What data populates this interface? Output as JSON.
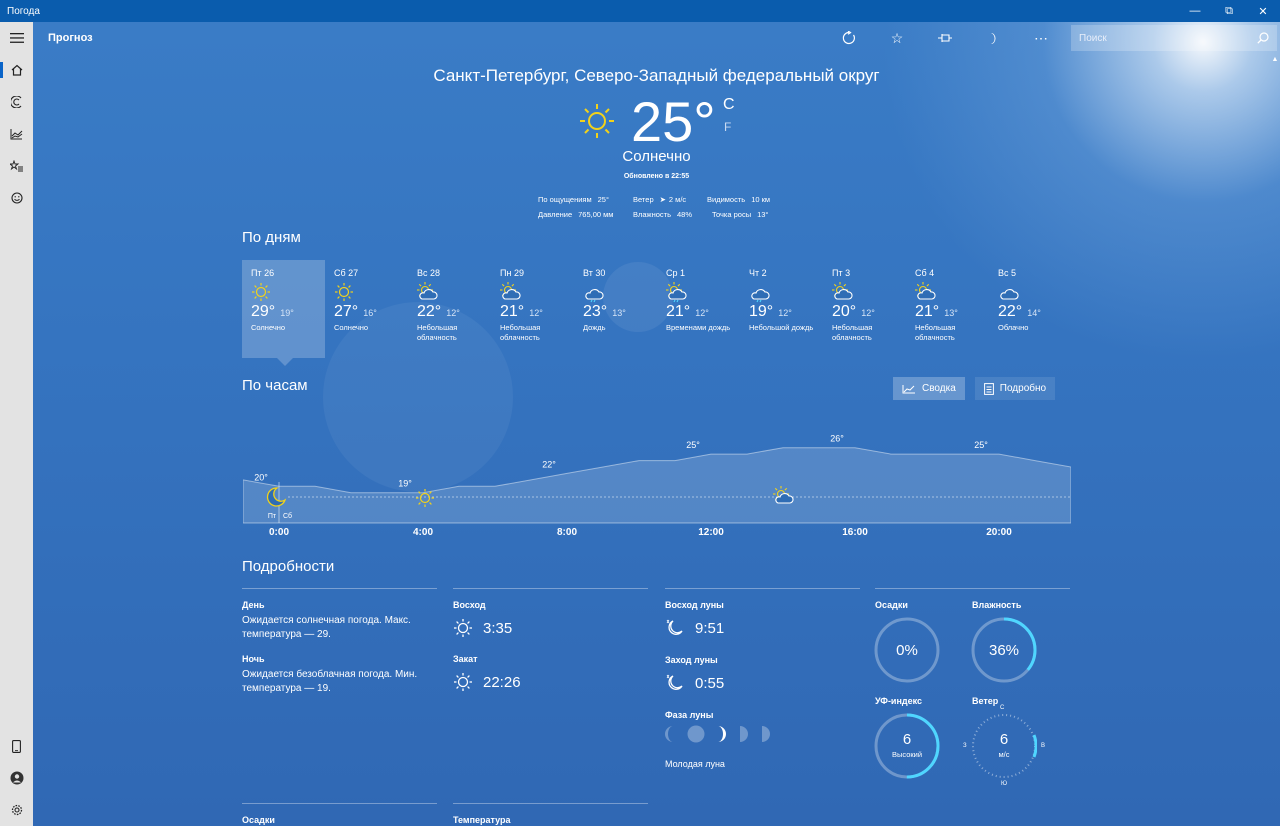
{
  "window": {
    "title": "Погода"
  },
  "nav": {
    "page_title": "Прогноз",
    "search_placeholder": "Поиск"
  },
  "current": {
    "location": "Санкт-Петербург, Северо-Западный федеральный округ",
    "temp": "25°",
    "unit_c": "C",
    "unit_f": "F",
    "condition": "Солнечно",
    "updated": "Обновлено в 22:55",
    "stats": {
      "feels_label": "По ощущениям",
      "feels_value": "25°",
      "wind_label": "Ветер",
      "wind_value": "2 м/с",
      "visibility_label": "Видимость",
      "visibility_value": "10 км",
      "pressure_label": "Давление",
      "pressure_value": "765,00 мм",
      "humidity_label": "Влажность",
      "humidity_value": "48%",
      "dew_label": "Точка росы",
      "dew_value": "13°"
    }
  },
  "daily": {
    "heading": "По дням",
    "days": [
      {
        "name": "Пт 26",
        "icon": "sun-icon",
        "hi": "29°",
        "lo": "19°",
        "cond": "Солнечно"
      },
      {
        "name": "Сб 27",
        "icon": "sun-icon",
        "hi": "27°",
        "lo": "16°",
        "cond": "Солнечно"
      },
      {
        "name": "Вс 28",
        "icon": "partly-cloudy-icon",
        "hi": "22°",
        "lo": "12°",
        "cond": "Небольшая облачность"
      },
      {
        "name": "Пн 29",
        "icon": "partly-cloudy-icon",
        "hi": "21°",
        "lo": "12°",
        "cond": "Небольшая облачность"
      },
      {
        "name": "Вт 30",
        "icon": "rain-icon",
        "hi": "23°",
        "lo": "13°",
        "cond": "Дождь"
      },
      {
        "name": "Ср 1",
        "icon": "sun-rain-icon",
        "hi": "21°",
        "lo": "12°",
        "cond": "Временами дождь"
      },
      {
        "name": "Чт 2",
        "icon": "rain-icon",
        "hi": "19°",
        "lo": "12°",
        "cond": "Небольшой дождь"
      },
      {
        "name": "Пт 3",
        "icon": "partly-cloudy-icon",
        "hi": "20°",
        "lo": "12°",
        "cond": "Небольшая облачность"
      },
      {
        "name": "Сб 4",
        "icon": "partly-cloudy-icon",
        "hi": "21°",
        "lo": "13°",
        "cond": "Небольшая облачность"
      },
      {
        "name": "Вс 5",
        "icon": "cloud-icon",
        "hi": "22°",
        "lo": "14°",
        "cond": "Облачно"
      }
    ]
  },
  "hourly": {
    "heading": "По часам",
    "summary_label": "Сводка",
    "detail_label": "Подробно",
    "day_labels": [
      "Пт",
      "Сб"
    ],
    "hour_labels": [
      "0:00",
      "4:00",
      "8:00",
      "12:00",
      "16:00",
      "20:00"
    ],
    "temp_points": [
      {
        "hour": 1,
        "label": "20°"
      },
      {
        "hour": 5,
        "label": "19°"
      },
      {
        "hour": 9,
        "label": "22°"
      },
      {
        "hour": 13,
        "label": "25°"
      },
      {
        "hour": 17,
        "label": "26°"
      },
      {
        "hour": 21,
        "label": "25°"
      }
    ],
    "temps": [
      21,
      20,
      20,
      19,
      19,
      19,
      20,
      20,
      21,
      22,
      23,
      24,
      24,
      25,
      25,
      26,
      26,
      26,
      25,
      25,
      25,
      25,
      24,
      23
    ]
  },
  "details": {
    "heading": "Подробности",
    "day_label": "День",
    "day_text": "Ожидается солнечная погода. Макс. температура — 29.",
    "night_label": "Ночь",
    "night_text": "Ожидается безоблачная погода. Мин. температура — 19.",
    "sunrise_label": "Восход",
    "sunrise_value": "3:35",
    "sunset_label": "Закат",
    "sunset_value": "22:26",
    "moonrise_label": "Восход луны",
    "moonrise_value": "9:51",
    "moonset_label": "Заход луны",
    "moonset_value": "0:55",
    "moon_phase_label": "Фаза луны",
    "moon_phase_value": "Молодая луна",
    "precip_label": "Осадки",
    "precip_value": "0%",
    "precip_fraction": 0,
    "humidity_label": "Влажность",
    "humidity_value": "36%",
    "humidity_fraction": 0.36,
    "uv_label": "УФ-индекс",
    "uv_value": "6",
    "uv_desc": "Высокий",
    "uv_fraction": 0.5,
    "wind_label": "Ветер",
    "wind_value": "6",
    "wind_unit": "м/с",
    "compass": {
      "n": "С",
      "s": "Ю",
      "w": "З",
      "e": "В"
    },
    "bottom_precip_label": "Осадки",
    "bottom_temp_label": "Температура"
  },
  "colors": {
    "accent": "#4fd6ff",
    "titlebar": "#0a5cad",
    "sun": "#f2d21a"
  }
}
